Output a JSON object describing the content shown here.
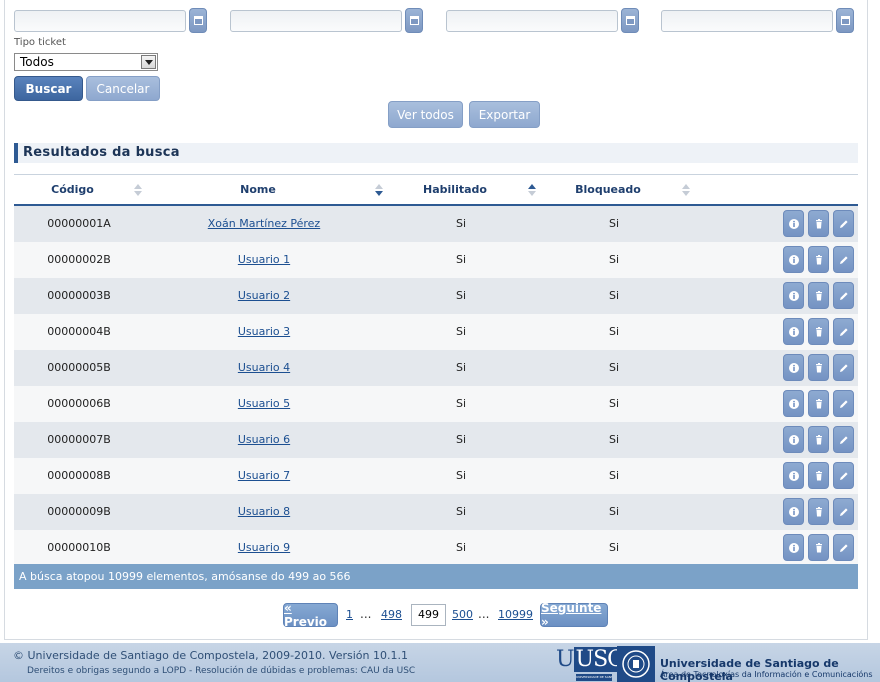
{
  "filters": {
    "tipo_ticket_label": "Tipo ticket",
    "tipo_ticket_value": "Todos",
    "buscar_label": "Buscar",
    "cancelar_label": "Cancelar",
    "ver_todos_label": "Ver todos",
    "exportar_label": "Exportar"
  },
  "results": {
    "title": "Resultados da busca",
    "columns": [
      "Código",
      "Nome",
      "Habilitado",
      "Bloqueado"
    ],
    "rows": [
      {
        "codigo": "00000001A",
        "nome": "Xoán Martínez Pérez",
        "habilitado": "Si",
        "bloqueado": "Si"
      },
      {
        "codigo": "00000002B",
        "nome": "Usuario 1",
        "habilitado": "Si",
        "bloqueado": "Si"
      },
      {
        "codigo": "00000003B",
        "nome": "Usuario 2",
        "habilitado": "Si",
        "bloqueado": "Si"
      },
      {
        "codigo": "00000004B",
        "nome": "Usuario 3",
        "habilitado": "Si",
        "bloqueado": "Si"
      },
      {
        "codigo": "00000005B",
        "nome": "Usuario 4",
        "habilitado": "Si",
        "bloqueado": "Si"
      },
      {
        "codigo": "00000006B",
        "nome": "Usuario 5",
        "habilitado": "Si",
        "bloqueado": "Si"
      },
      {
        "codigo": "00000007B",
        "nome": "Usuario 6",
        "habilitado": "Si",
        "bloqueado": "Si"
      },
      {
        "codigo": "00000008B",
        "nome": "Usuario 7",
        "habilitado": "Si",
        "bloqueado": "Si"
      },
      {
        "codigo": "00000009B",
        "nome": "Usuario 8",
        "habilitado": "Si",
        "bloqueado": "Si"
      },
      {
        "codigo": "00000010B",
        "nome": "Usuario 9",
        "habilitado": "Si",
        "bloqueado": "Si"
      }
    ],
    "status": "A búsca atopou 10999 elementos, amósanse do 499 ao 566"
  },
  "pagination": {
    "previo": "« Previo",
    "first": "1",
    "dots": "...",
    "p498": "498",
    "current": "499",
    "p500": "500",
    "last": "10999",
    "seguinte": "Seguinte »"
  },
  "footer": {
    "copyright": "© Universidade de Santiago de Compostela, 2009-2010. Versión 10.1.1",
    "links": "Dereitos e obrigas segundo a LOPD - Resolución de dúbidas e problemas: CAU da USC",
    "logo_text": "USC",
    "logo_sub": "UNIVERSIDADE DE SANTIAGO",
    "uni_name": "Universidade de Santiago de Compostela",
    "area": "Área de Tecnoloxías da Información e Comunicacións"
  },
  "colors": {
    "primary": "#3d669f",
    "accent_light": "#8ea8cf",
    "status_bar": "#7ba2c8"
  }
}
